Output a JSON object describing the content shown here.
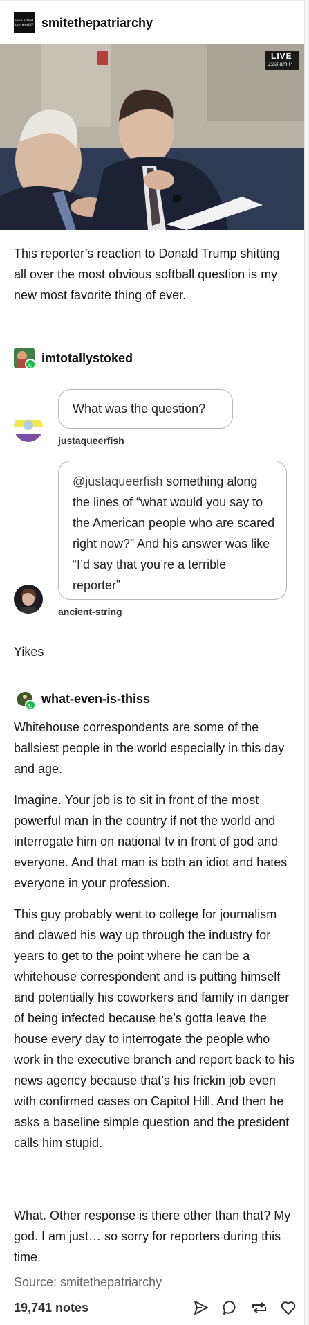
{
  "post": {
    "blog_name": "smitethepatriarchy",
    "avatar_text": "who killed the world?",
    "live_badge": {
      "label": "LIVE",
      "time": "9:33 am PT"
    },
    "caption": "This reporter’s reaction to Donald Trump shitting all over the most obvious softball question is my new most favorite thing of ever."
  },
  "reblogs": [
    {
      "blog_name": "imtotallystoked",
      "ask": {
        "text": "What was the question?",
        "asker": "justaqueerfish"
      },
      "answer": {
        "mention": "@justaqueerfish",
        "text": " something along the lines of “what would you say to the American people who are scared right now?” And his answer was like “I’d say that you’re a terrible reporter”",
        "asker": "ancient-string"
      },
      "comment": "Yikes"
    },
    {
      "blog_name": "what-even-is-thiss",
      "paragraphs": [
        "Whitehouse correspondents are some of the ballsiest people in the world especially in this day and age.",
        "Imagine. Your job is to sit in front of the most powerful man in the country if not the world and interrogate him on national tv in front of god and everyone. And that man is both an idiot and hates everyone in your profession.",
        "This guy probably went to college for journalism and clawed his way up through the industry for years to get to the point where he can be a whitehouse correspondent and is putting himself and potentially his coworkers and family in danger of being infected because he’s gotta leave the house every day to interrogate the people who work in the executive branch and report back to his news agency because that’s his frickin job even with confirmed cases on Capitol Hill. And then he asks a baseline simple question and the president calls him stupid.",
        "What. Other response is there other than that? My god. I am just… so sorry for reporters during this time."
      ]
    }
  ],
  "source": "Source: smitethepatriarchy",
  "footer": {
    "notes": "19,741 notes",
    "icons": [
      "share-icon",
      "reply-icon",
      "reblog-icon",
      "like-icon"
    ]
  },
  "colors": {
    "reblog_badge": "#19b84a",
    "bubble_border": "#b5b5b5"
  }
}
